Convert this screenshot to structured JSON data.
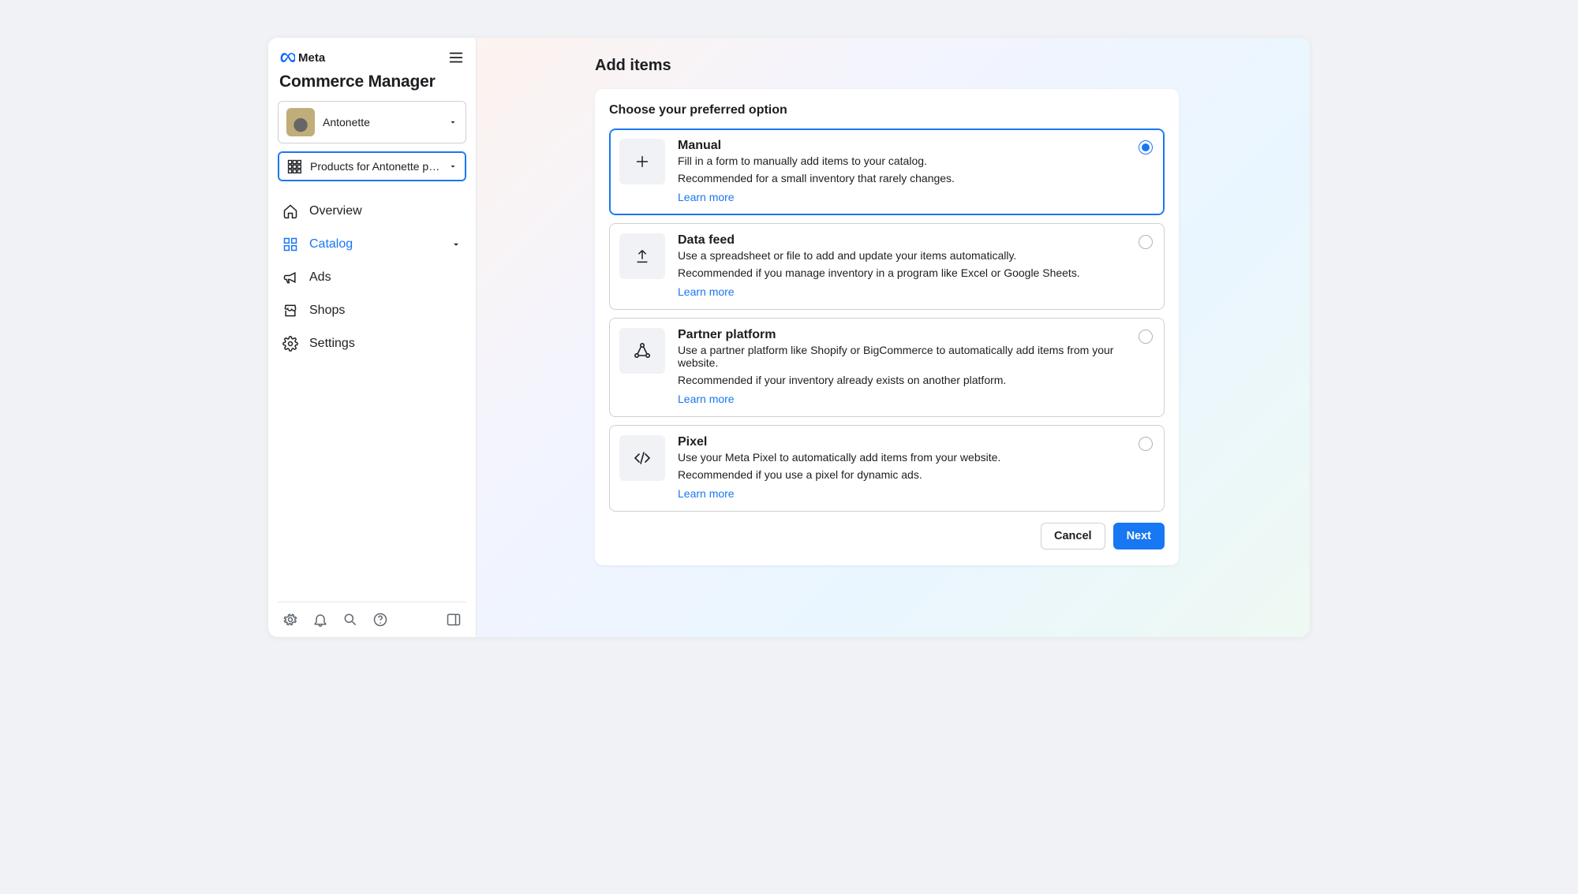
{
  "brand": {
    "name": "Meta"
  },
  "app_title": "Commerce Manager",
  "account_selector": {
    "label": "Antonette"
  },
  "catalog_selector": {
    "label": "Products for Antonette pers..."
  },
  "nav": {
    "overview": "Overview",
    "catalog": "Catalog",
    "ads": "Ads",
    "shops": "Shops",
    "settings": "Settings"
  },
  "page": {
    "title": "Add items",
    "card_title": "Choose your preferred option",
    "options": [
      {
        "title": "Manual",
        "desc": "Fill in a form to manually add items to your catalog.",
        "reco": "Recommended for a small inventory that rarely changes.",
        "link": "Learn more"
      },
      {
        "title": "Data feed",
        "desc": "Use a spreadsheet or file to add and update your items automatically.",
        "reco": "Recommended if you manage inventory in a program like Excel or Google Sheets.",
        "link": "Learn more"
      },
      {
        "title": "Partner platform",
        "desc": "Use a partner platform like Shopify or BigCommerce to automatically add items from your website.",
        "reco": "Recommended if your inventory already exists on another platform.",
        "link": "Learn more"
      },
      {
        "title": "Pixel",
        "desc": "Use your Meta Pixel to automatically add items from your website.",
        "reco": "Recommended if you use a pixel for dynamic ads.",
        "link": "Learn more"
      }
    ],
    "cancel": "Cancel",
    "next": "Next"
  }
}
